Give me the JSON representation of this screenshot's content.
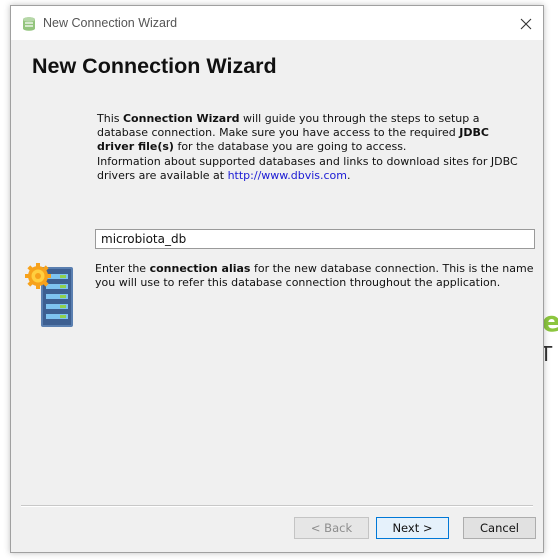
{
  "window": {
    "title": "New Connection Wizard",
    "icon": "dbvis-app-icon",
    "close_icon": "close-icon"
  },
  "wizard": {
    "heading": "New Connection Wizard",
    "intro": {
      "p1_a": "This ",
      "p1_b": "Connection Wizard",
      "p1_c": " will guide you through the steps to setup a database connection. Make sure you have access to the required ",
      "p1_d": "JDBC driver file(s)",
      "p1_e": " for the database you are going to access.",
      "p2_a": "Information about supported databases and links to download sites for JDBC drivers are available at ",
      "p2_link": "http://www.dbvis.com",
      "p2_b": "."
    },
    "alias_input_value": "microbiota_db",
    "alias_help": {
      "a": "Enter the ",
      "b": "connection alias",
      "c": " for the new database connection. This is the name you will use to refer this database connection throughout the application."
    },
    "illustration_icon": "database-server-icon"
  },
  "buttons": {
    "back": "< Back",
    "next": "Next >",
    "cancel": "Cancel"
  },
  "colors": {
    "link": "#1a1ad4",
    "default_button_border": "#0078d7",
    "dialog_bg": "#f0f0f0"
  }
}
